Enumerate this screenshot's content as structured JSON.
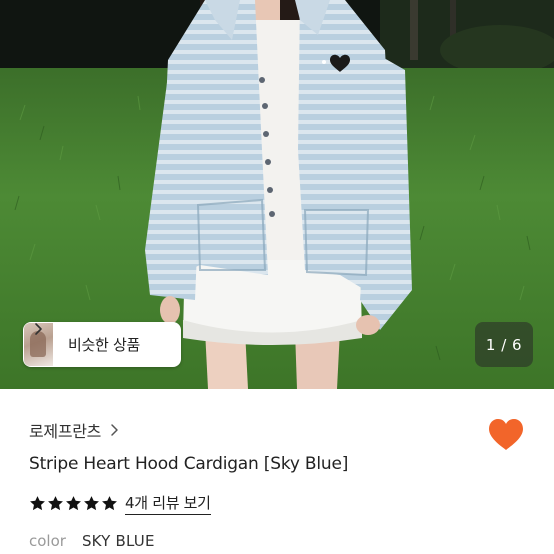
{
  "carousel": {
    "image_alt": "Model wearing stripe heart hood cardigan on grass",
    "page_indicator": "1 / 6"
  },
  "similar_products": {
    "label": "비슷한 상품",
    "chevron_icon": "chevron-right-icon"
  },
  "product": {
    "store_name": "로제프란츠",
    "title": "Stripe Heart Hood Cardigan [Sky Blue]",
    "rating_stars": 5,
    "review_link": "4개 리뷰 보기",
    "option_label": "color",
    "option_value": "SKY BLUE"
  },
  "icons": {
    "like": "heart-icon",
    "star": "star-icon",
    "store_chevron": "chevron-right-icon"
  },
  "colors": {
    "like_heart": "#F2652A",
    "star": "#111111",
    "grass": "#3F7A2C",
    "cardigan": "#AFC6D6"
  }
}
